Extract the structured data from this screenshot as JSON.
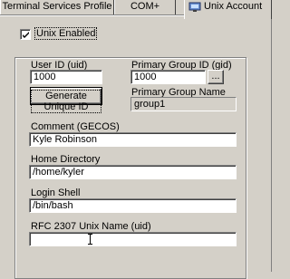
{
  "tabs": [
    {
      "label": "Terminal Services Profile"
    },
    {
      "label": "COM+"
    },
    {
      "label": "Unix Account"
    }
  ],
  "unix_enabled": {
    "label": "Unix Enabled",
    "checked": true
  },
  "user_id": {
    "label": "User ID (uid)",
    "value": "1000"
  },
  "generate_button": {
    "label": "Generate Unique ID"
  },
  "primary_group_id": {
    "label": "Primary Group ID (gid)",
    "value": "1000",
    "browse_label": "..."
  },
  "primary_group_name": {
    "label": "Primary Group Name",
    "value": "group1"
  },
  "comment": {
    "label": "Comment  (GECOS)",
    "value": "Kyle Robinson"
  },
  "home_directory": {
    "label": "Home Directory",
    "value": "/home/kyler"
  },
  "login_shell": {
    "label": "Login Shell",
    "value": "/bin/bash"
  },
  "rfc_name": {
    "label": "RFC 2307 Unix Name (uid)",
    "value": ""
  }
}
